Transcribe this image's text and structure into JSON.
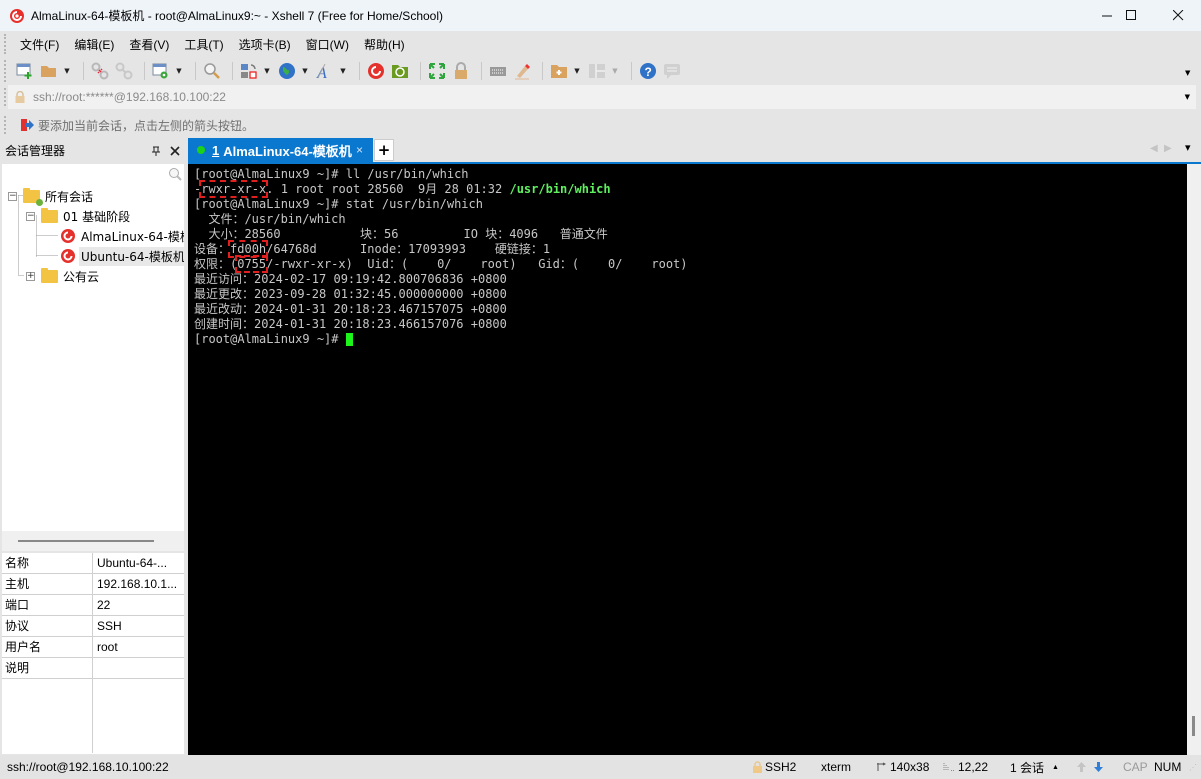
{
  "window": {
    "title": "AlmaLinux-64-模板机 - root@AlmaLinux9:~ - Xshell 7 (Free for Home/School)",
    "minimize_icon": "minimize-icon",
    "maximize_icon": "maximize-icon",
    "close_icon": "close-icon"
  },
  "menu": {
    "items": [
      {
        "label": "文件(F)"
      },
      {
        "label": "编辑(E)"
      },
      {
        "label": "查看(V)"
      },
      {
        "label": "工具(T)"
      },
      {
        "label": "选项卡(B)"
      },
      {
        "label": "窗口(W)"
      },
      {
        "label": "帮助(H)"
      }
    ]
  },
  "toolbar": {
    "icons": [
      "new-session-icon",
      "open-folder-icon",
      "disconnect-icon",
      "reconnect-icon",
      "session-properties-icon",
      "find-icon",
      "transfer-icon",
      "globe-icon",
      "font-icon",
      "xshell-icon",
      "xftp-icon",
      "fullscreen-icon",
      "lock-icon",
      "keyboard-icon",
      "highlight-icon",
      "new-folder-icon",
      "layout-icon",
      "help-icon",
      "chat-icon"
    ]
  },
  "address_bar": {
    "value": "ssh://root:******@192.168.10.100:22"
  },
  "hint_bar": {
    "text": "要添加当前会话，点击左侧的箭头按钮。"
  },
  "session_manager": {
    "title": "会话管理器",
    "pin_label": "ㅁ",
    "close_label": "✕",
    "search_placeholder": "",
    "tree": {
      "root": "所有会话",
      "group1": "01 基础阶段",
      "session1": "AlmaLinux-64-模板机",
      "session2": "Ubuntu-64-模板机",
      "group2": "公有云"
    },
    "properties": [
      {
        "key": "名称",
        "value": "Ubuntu-64-..."
      },
      {
        "key": "主机",
        "value": "192.168.10.1..."
      },
      {
        "key": "端口",
        "value": "22"
      },
      {
        "key": "协议",
        "value": "SSH"
      },
      {
        "key": "用户名",
        "value": "root"
      },
      {
        "key": "说明",
        "value": ""
      }
    ]
  },
  "tabs": {
    "active": {
      "number": "1",
      "label": "AlmaLinux-64-模板机",
      "status_color": "#1bd11b"
    },
    "close_label": "×",
    "add_label": "+",
    "prev_label": "◀",
    "next_label": "▶",
    "menu_label": "▾"
  },
  "terminal": {
    "lines": [
      {
        "text": "[root@AlmaLinux9 ~]# ll /usr/bin/which"
      },
      {
        "prefix": "-",
        "boxed": "rwxr-xr-x",
        "mid": ". 1 root root 28560  9月 28 01:32 ",
        "green": "/usr/bin/which"
      },
      {
        "text": "[root@AlmaLinux9 ~]# stat /usr/bin/which"
      },
      {
        "text": "  文件：/usr/bin/which"
      },
      {
        "text": "  大小：28560           块：56         IO 块：4096   普通文件"
      },
      {
        "pre": "设备：",
        "boxed": "fd00h",
        "post": "/64768d      Inode：17093993    硬链接：1"
      },
      {
        "pre": "权限：(",
        "boxed": "0755",
        "post": "/-rwxr-xr-x)  Uid：(    0/    root)   Gid：(    0/    root)"
      },
      {
        "text": "最近访问：2024-02-17 09:19:42.800706836 +0800"
      },
      {
        "text": "最近更改：2023-09-28 01:32:45.000000000 +0800"
      },
      {
        "text": "最近改动：2024-01-31 20:18:23.467157075 +0800"
      },
      {
        "text": "创建时间：2024-01-31 20:18:23.466157076 +0800"
      },
      {
        "text": "[root@AlmaLinux9 ~]# "
      }
    ]
  },
  "status_bar": {
    "connection": "ssh://root@192.168.10.100:22",
    "protocol": "SSH2",
    "terminal_type": "xterm",
    "size": "140x38",
    "cursor_pos": "12,22",
    "sessions": "1 会话",
    "caps": "CAP",
    "num": "NUM"
  }
}
